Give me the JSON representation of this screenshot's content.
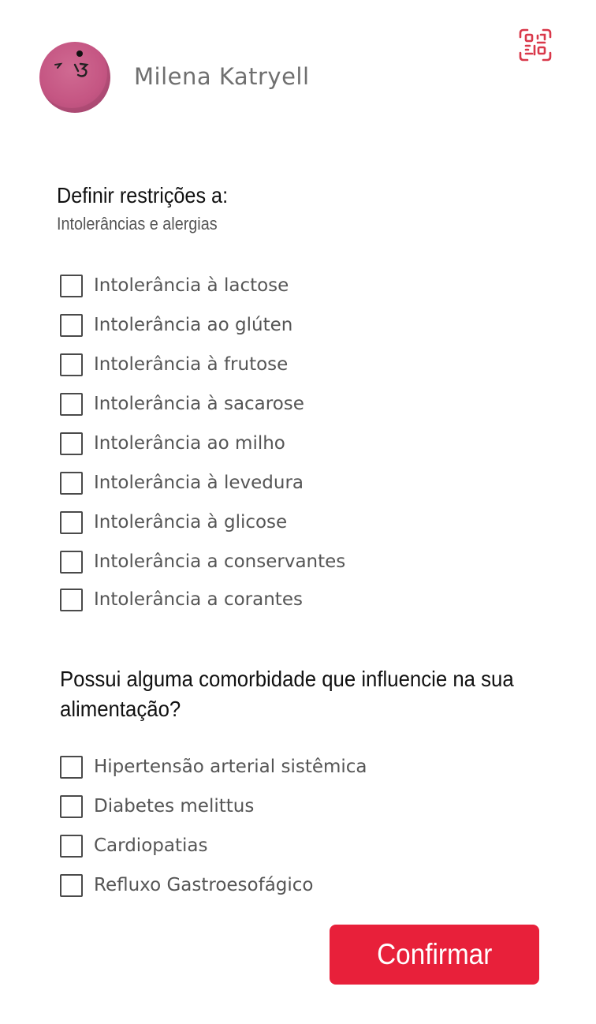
{
  "header": {
    "user_name": "Milena Katryell",
    "qr_icon": "qr-code-scan-icon",
    "accent_color": "#e8203a"
  },
  "restrictions": {
    "title": "Definir restrições a:",
    "subtitle": "Intolerâncias e alergias",
    "options": [
      {
        "label": "Intolerância à lactose",
        "checked": false
      },
      {
        "label": "Intolerância ao glúten",
        "checked": false
      },
      {
        "label": "Intolerância à frutose",
        "checked": false
      },
      {
        "label": "Intolerância à sacarose",
        "checked": false
      },
      {
        "label": "Intolerância ao milho",
        "checked": false
      },
      {
        "label": "Intolerância à levedura",
        "checked": false
      },
      {
        "label": "Intolerância à glicose",
        "checked": false
      },
      {
        "label": "Intolerância a conservantes",
        "checked": false
      },
      {
        "label": "Intolerância a corantes",
        "checked": false
      }
    ]
  },
  "comorbidities": {
    "question": "Possui alguma comorbidade que influencie na sua alimentação?",
    "options": [
      {
        "label": "Hipertensão arterial sistêmica",
        "checked": false
      },
      {
        "label": "Diabetes melittus",
        "checked": false
      },
      {
        "label": "Cardiopatias",
        "checked": false
      },
      {
        "label": "Refluxo Gastroesofágico",
        "checked": false
      }
    ]
  },
  "actions": {
    "confirm_label": "Confirmar"
  }
}
